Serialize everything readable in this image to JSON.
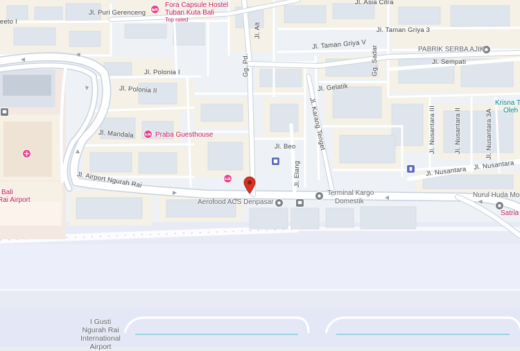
{
  "map": {
    "colors": {
      "block": "#f5f1e6",
      "road": "#ffffff",
      "road_edge": "#c9d2dc",
      "airport": "#e8eaf6",
      "runway": "#dfe3f3",
      "green": "#dfe9d8",
      "poi_pink": "#e8438b",
      "poi_grey": "#7b8088",
      "poi_blue": "#5c6bc0",
      "pin_red": "#d93025"
    },
    "streets": [
      {
        "id": "jl-puri-gerenceng",
        "text": "Jl. Puri Gerenceng"
      },
      {
        "id": "jl-asia-citra",
        "text": "Jl. Asia Citra"
      },
      {
        "id": "jl-taman-griya-3",
        "text": "Jl. Taman Griya 3"
      },
      {
        "id": "jl-taman-griya-v",
        "text": "Jl. Taman Griya V"
      },
      {
        "id": "jl-alt",
        "text": "Jl. Alt"
      },
      {
        "id": "gg-pd",
        "text": "Gg. Pd."
      },
      {
        "id": "gg-sadar",
        "text": "Gg. Sadar"
      },
      {
        "id": "jl-sempati",
        "text": "Jl. Sempati"
      },
      {
        "id": "jl-polonia-ii",
        "text": "Jl. Polonia II"
      },
      {
        "id": "jl-polonia-i",
        "text": "Jl. Polonia I"
      },
      {
        "id": "jl-gelatik",
        "text": "Jl. Gelatik"
      },
      {
        "id": "jl-mandala",
        "text": "Jl. Mandala"
      },
      {
        "id": "jl-karang-tenget",
        "text": "Jl. Karang Tenget"
      },
      {
        "id": "jl-beo",
        "text": "Jl. Beo"
      },
      {
        "id": "jl-elang",
        "text": "Jl. Elang"
      },
      {
        "id": "jl-airport-ngurah-rai",
        "text": "Jl. Airport Ngurah Rai"
      },
      {
        "id": "jl-nusantara-iii",
        "text": "Jl. Nusantara III"
      },
      {
        "id": "jl-nusantara-ii",
        "text": "Jl. Nusantara II"
      },
      {
        "id": "jl-nusantara-3a",
        "text": "Jl. Nusantara 3A"
      },
      {
        "id": "jl-nusantara",
        "text": "Jl. Nusantara"
      },
      {
        "id": "jl-nusantara-2",
        "text": "Jl. Nusantara"
      },
      {
        "id": "teeto",
        "text": "teeto I"
      }
    ],
    "places": {
      "fora": {
        "name": "Fora Capsule Hostel",
        "name2": "Tuban Kuta Bali",
        "note": "Top rated"
      },
      "praba": {
        "name": "Praba Guesthouse"
      },
      "pabrik": {
        "name": "PABRIK SERBA AJIK"
      },
      "aerofood": {
        "name": "Aerofood ACS Denpasar"
      },
      "kargo": {
        "name": "Terminal Kargo",
        "name2": "Domestik"
      },
      "nurul": {
        "name": "Nurul Huda Mos"
      },
      "satria": {
        "name": "Satria"
      },
      "krisna": {
        "name": "Krisna T",
        "name2": "Oleh"
      },
      "baliairport": {
        "name": "l Bali",
        "name2": "Rai Airport"
      },
      "igusti": {
        "name": "I Gusti",
        "name2": "Ngurah Rai",
        "name3": "International",
        "name4": "Airport"
      }
    }
  }
}
